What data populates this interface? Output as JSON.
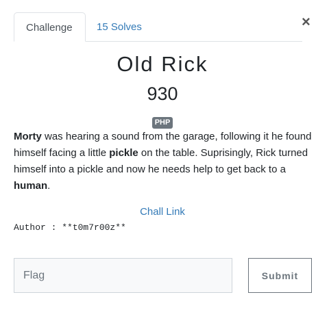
{
  "tabs": {
    "challenge": "Challenge",
    "solves": "15 Solves"
  },
  "close_icon": "×",
  "challenge": {
    "name": "Old Rick",
    "points": "930",
    "tag": "PHP",
    "description": {
      "w1": "Morty",
      "t1": " was hearing a sound from the garage, following it he found himself facing a little ",
      "w2": "pickle",
      "t2": " on the table. Suprisingly, Rick turned himself into a pickle and now he needs help to get back to a ",
      "w3": "human",
      "t3": "."
    },
    "link_text": "Chall Link",
    "author": "Author : **t0m7r00z**"
  },
  "form": {
    "flag_placeholder": "Flag",
    "flag_value": "",
    "submit_label": "Submit"
  },
  "colors": {
    "link": "#337ab7",
    "tag_bg": "#6c757d",
    "input_bg": "#f8f9fa"
  }
}
